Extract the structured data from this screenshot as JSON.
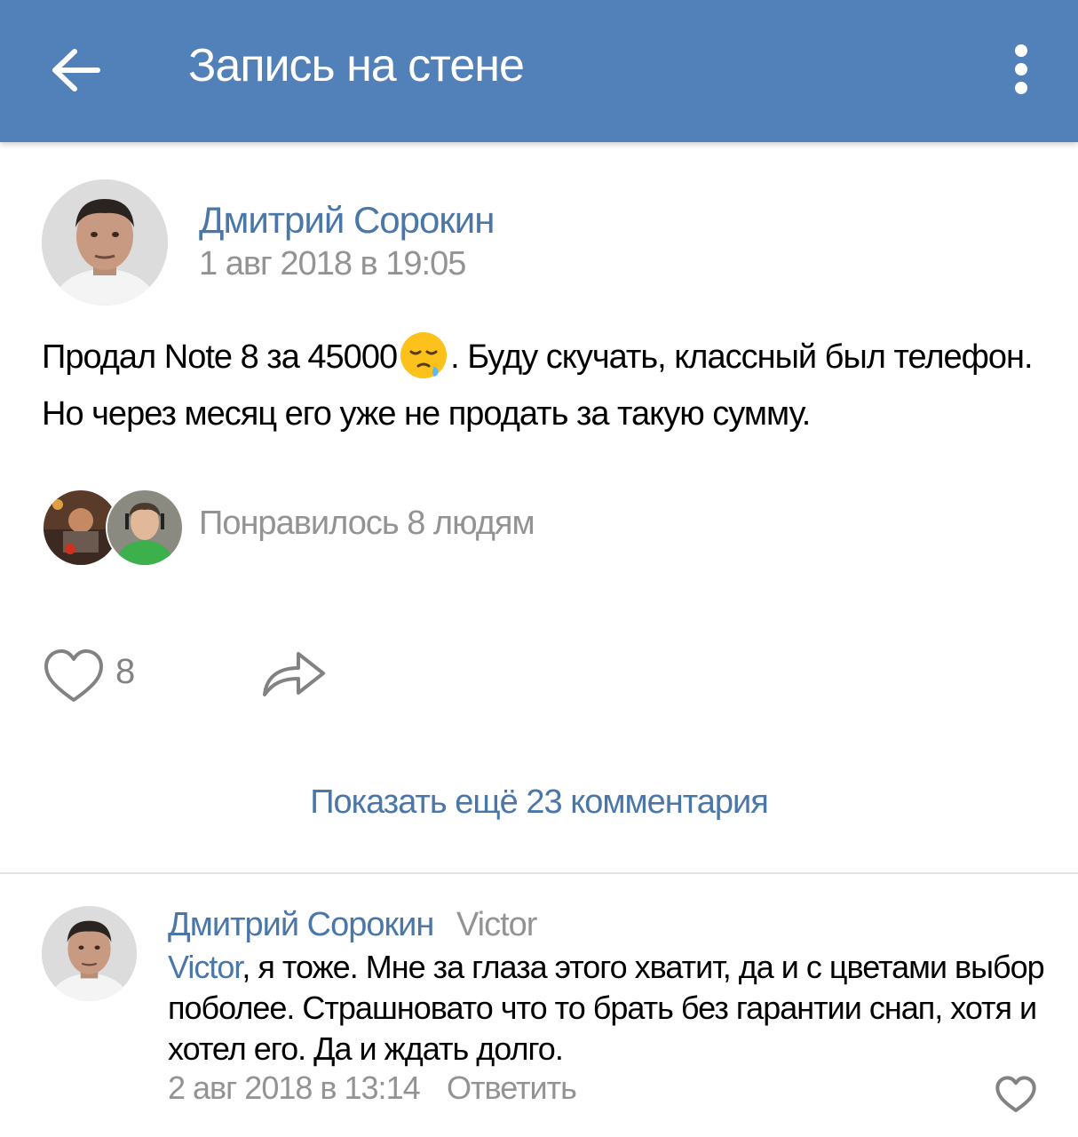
{
  "header": {
    "title": "Запись на стене",
    "background_color": "#5181b8",
    "back_icon": "arrow-left-icon",
    "menu_icon": "more-vertical-icon"
  },
  "post": {
    "author": "Дмитрий Сорокин",
    "date": "1 авг 2018 в 19:05",
    "text_before_emoji": "Продал Note 8 за 45000",
    "emoji": "sleepy-face-emoji",
    "text_after_emoji": ". Буду скучать, классный был телефон. Но через месяц его уже не продать за такую сумму.",
    "liked_by_text": "Понравилось 8 людям",
    "like_count": "8",
    "like_icon": "heart-outline-icon",
    "share_icon": "share-arrow-icon"
  },
  "comments_section": {
    "show_more_label": "Показать ещё 23 комментария"
  },
  "comment": {
    "author": "Дмитрий Сорокин",
    "reply_to": "Victor",
    "mention": "Victor",
    "text": ", я тоже. Мне за глаза этого хватит, да и с цветами выбор поболее. Страшновато что то брать без гарантии снап, хотя и хотел его. Да и ждать долго.",
    "date": "2 авг 2018 в 13:14",
    "reply_label": "Ответить",
    "like_icon": "heart-outline-icon"
  },
  "colors": {
    "link": "#4a76a8",
    "secondary_text": "#939393",
    "icon_gray": "#828282"
  }
}
